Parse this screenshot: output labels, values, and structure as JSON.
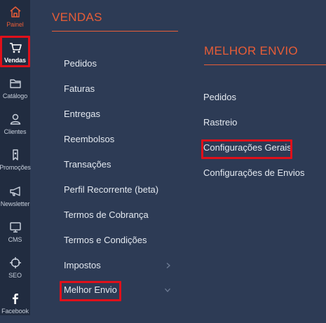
{
  "rail": {
    "painel": "Painel",
    "vendas": "Vendas",
    "catalogo": "Catálogo",
    "clientes": "Clientes",
    "promocoes": "Promoções",
    "newsletter": "Newsletter",
    "cms": "CMS",
    "seo": "SEO",
    "facebook": "Facebook"
  },
  "vendas": {
    "title": "VENDAS",
    "items": {
      "pedidos": "Pedidos",
      "faturas": "Faturas",
      "entregas": "Entregas",
      "reembolsos": "Reembolsos",
      "transacoes": "Transações",
      "perfil": "Perfil Recorrente (beta)",
      "termos_cobranca": "Termos de Cobrança",
      "termos_condicoes": "Termos e Condições",
      "impostos": "Impostos",
      "melhor_envio": "Melhor Envio"
    }
  },
  "melhor_envio": {
    "title": "MELHOR ENVIO",
    "items": {
      "pedidos": "Pedidos",
      "rastreio": "Rastreio",
      "config_gerais": "Configurações Gerais",
      "config_envios": "Configurações de Envios"
    }
  },
  "colors": {
    "accent": "#e85d37",
    "highlight": "#e0101a",
    "rail_bg": "#212c40",
    "panel_bg": "#2d3b55"
  },
  "icons": {
    "painel": "home-icon",
    "vendas": "cart-icon",
    "catalogo": "folder-icon",
    "clientes": "user-icon",
    "promocoes": "tag-icon",
    "newsletter": "megaphone-icon",
    "cms": "monitor-icon",
    "seo": "crosshair-icon",
    "facebook": "facebook-icon",
    "chevron_right": "chevron-right-icon",
    "chevron_down": "chevron-down-icon"
  }
}
